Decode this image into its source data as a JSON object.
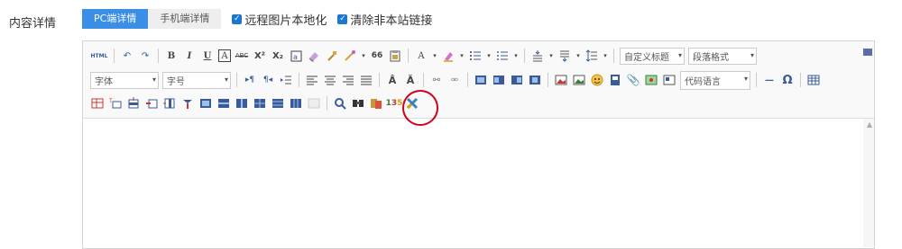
{
  "label": "内容详情",
  "tabs": [
    "PC端详情",
    "手机端详情"
  ],
  "options": [
    {
      "label": "远程图片本地化",
      "checked": true
    },
    {
      "label": "清除非本站链接",
      "checked": true
    }
  ],
  "toolbar": {
    "html": "HTML",
    "bold": "B",
    "italic": "I",
    "underline": "U",
    "border": "A",
    "strike": "ABC",
    "superscript": "X²",
    "subscript": "X₂",
    "quote": "66",
    "fontcolor": "A",
    "custom_title": "自定义标题",
    "paragraph": "段落格式",
    "font": "字体",
    "fontsize": "字号",
    "code_lang": "代码语言",
    "hr": "—",
    "omega": "Ω"
  }
}
